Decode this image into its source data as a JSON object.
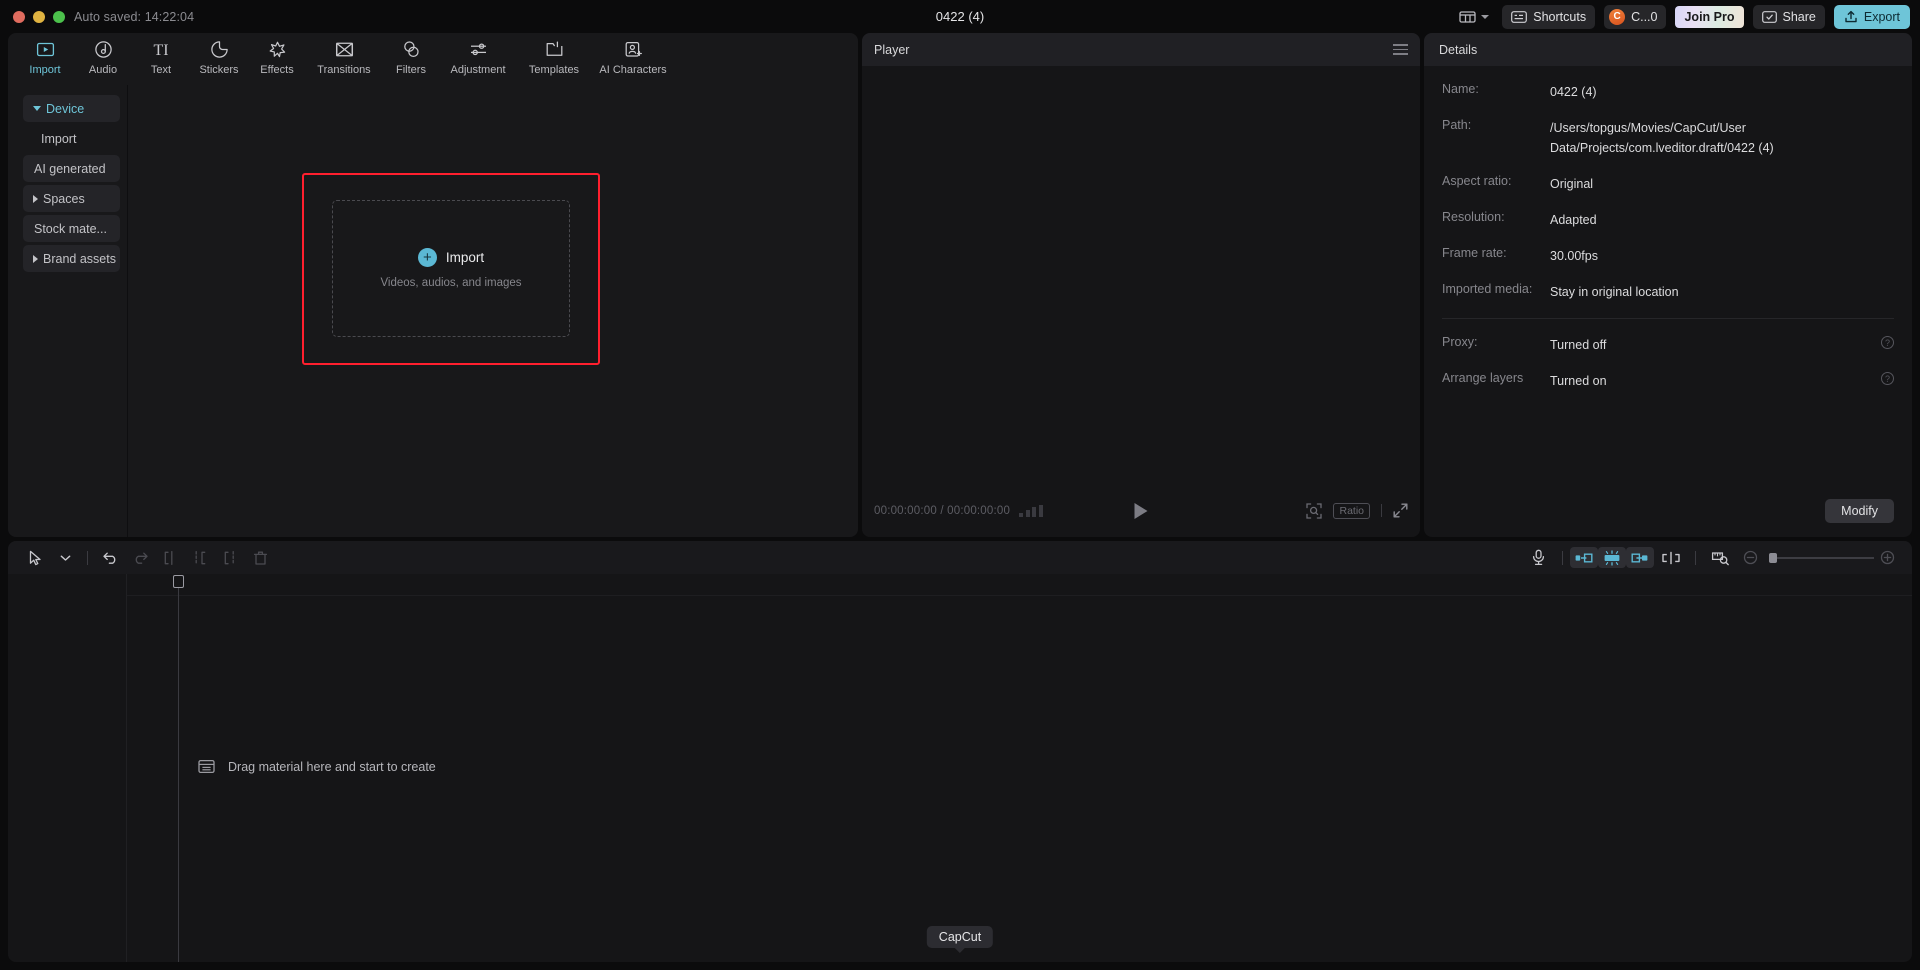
{
  "titlebar": {
    "autosave": "Auto saved: 14:22:04",
    "project_title": "0422 (4)",
    "layout_icon": "layout-grid-icon",
    "shortcuts_label": "Shortcuts",
    "account_label": "C...0",
    "account_initial": "C",
    "join_pro_label": "Join Pro",
    "share_label": "Share",
    "export_label": "Export",
    "export_color": "#6ec5d8"
  },
  "tabs": [
    {
      "label": "Import",
      "icon": "import-icon",
      "active": true
    },
    {
      "label": "Audio",
      "icon": "audio-note-icon",
      "active": false
    },
    {
      "label": "Text",
      "icon": "text-ti-icon",
      "active": false
    },
    {
      "label": "Stickers",
      "icon": "sticker-icon",
      "active": false
    },
    {
      "label": "Effects",
      "icon": "effects-sparkle-icon",
      "active": false
    },
    {
      "label": "Transitions",
      "icon": "transitions-icon",
      "active": false
    },
    {
      "label": "Filters",
      "icon": "filters-icon",
      "active": false
    },
    {
      "label": "Adjustment",
      "icon": "adjustment-sliders-icon",
      "active": false
    },
    {
      "label": "Templates",
      "icon": "templates-icon",
      "active": false
    },
    {
      "label": "AI Characters",
      "icon": "ai-characters-icon",
      "active": false
    }
  ],
  "sidebar": {
    "items": [
      {
        "label": "Device",
        "type": "group",
        "expanded": true,
        "selected": true
      },
      {
        "label": "Import",
        "type": "sub",
        "expanded": false,
        "selected": false
      },
      {
        "label": "AI generated",
        "type": "group",
        "expanded": false,
        "selected": false
      },
      {
        "label": "Spaces",
        "type": "group",
        "expanded": false,
        "selected": false
      },
      {
        "label": "Stock mate...",
        "type": "group",
        "expanded": false,
        "selected": false
      },
      {
        "label": "Brand assets",
        "type": "group",
        "expanded": false,
        "selected": false
      }
    ]
  },
  "dropzone": {
    "import_label": "Import",
    "import_sub": "Videos, audios, and images",
    "highlight_color": "#ff1f2e",
    "plus_icon": "plus-circle-icon"
  },
  "player": {
    "title": "Player",
    "menu_icon": "hamburger-menu-icon",
    "current_time": "00:00:00:00",
    "total_time": "00:00:00:00",
    "timecode": "00:00:00:00 / 00:00:00:00",
    "play_icon": "play-triangle-icon",
    "crop_icon": "crop-zoom-icon",
    "ratio_label": "Ratio",
    "fullscreen_icon": "fullscreen-icon"
  },
  "details": {
    "title": "Details",
    "rows": [
      {
        "label": "Name:",
        "value": "0422 (4)",
        "help": false
      },
      {
        "label": "Path:",
        "value": "/Users/topgus/Movies/CapCut/User Data/Projects/com.lveditor.draft/0422 (4)",
        "help": false
      },
      {
        "label": "Aspect ratio:",
        "value": "Original",
        "help": false
      },
      {
        "label": "Resolution:",
        "value": "Adapted",
        "help": false
      },
      {
        "label": "Frame rate:",
        "value": "30.00fps",
        "help": false
      },
      {
        "label": "Imported media:",
        "value": "Stay in original location",
        "help": false
      }
    ],
    "rows2": [
      {
        "label": "Proxy:",
        "value": "Turned off",
        "help": true
      },
      {
        "label": "Arrange layers",
        "value": "Turned on",
        "help": true
      }
    ],
    "help_glyph": "?",
    "modify_label": "Modify"
  },
  "timeline": {
    "tools_left": [
      {
        "icon": "select-arrow-icon",
        "dim": false
      },
      {
        "icon": "chevron-down-icon",
        "dim": false
      },
      {
        "icon": "undo-icon",
        "dim": false
      },
      {
        "icon": "redo-icon",
        "dim": true
      },
      {
        "icon": "split-icon",
        "dim": true
      },
      {
        "icon": "trim-left-icon",
        "dim": true
      },
      {
        "icon": "trim-right-icon",
        "dim": true
      },
      {
        "icon": "delete-icon",
        "dim": true
      }
    ],
    "tools_right": [
      {
        "icon": "microphone-icon",
        "on": false
      },
      {
        "icon": "snap-left-icon",
        "on": true
      },
      {
        "icon": "auto-snap-icon",
        "on": true
      },
      {
        "icon": "snap-right-icon",
        "on": true
      },
      {
        "icon": "mirror-split-icon",
        "on": false
      },
      {
        "icon": "ruler-zoom-icon",
        "on": false
      }
    ],
    "zoom_out_icon": "zoom-out-icon",
    "zoom_in_icon": "zoom-in-icon",
    "empty_message": "Drag material here and start to create",
    "empty_icon": "media-placeholder-icon"
  },
  "tooltip": {
    "label": "CapCut"
  }
}
